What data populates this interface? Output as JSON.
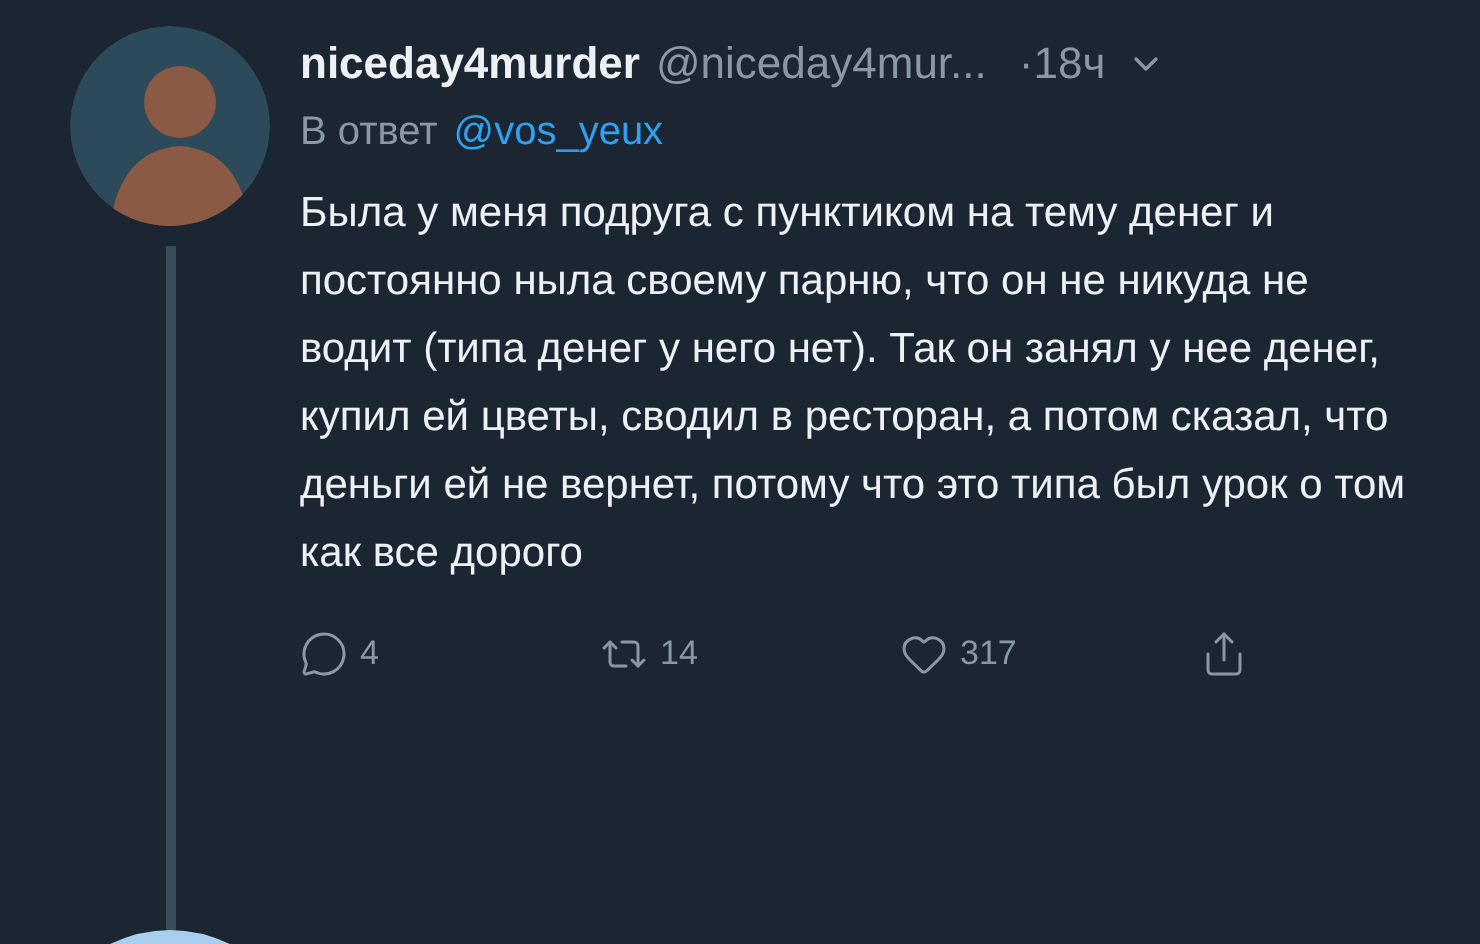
{
  "tweet": {
    "display_name": "niceday4murder",
    "handle": "@niceday4mur...",
    "time": "·18ч",
    "reply_prefix": "В ответ",
    "reply_to": "@vos_yeux",
    "text": "Была у меня подруга с пунктиком на тему денег и постоянно ныла своему парню, что он не никуда не водит (типа денег у него нет). Так он занял у нее денег, купил ей цветы, сводил в ресторан, а потом сказал, что деньги ей не вернет, потому что это типа был урок о том как все дорого",
    "actions": [
      {
        "kind": "reply",
        "count": "4"
      },
      {
        "kind": "retweet",
        "count": "14"
      },
      {
        "kind": "like",
        "count": "317"
      },
      {
        "kind": "share"
      }
    ]
  }
}
